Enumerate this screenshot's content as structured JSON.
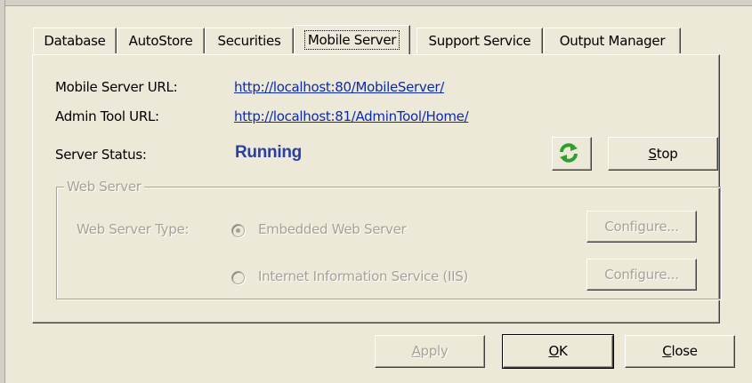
{
  "tabs": [
    "Database",
    "AutoStore",
    "Securities",
    "Mobile Server",
    "Support Service",
    "Output Manager"
  ],
  "active_tab": "Mobile Server",
  "mobile_server_url_label": "Mobile Server URL:",
  "mobile_server_url": "http://localhost:80/MobileServer/",
  "admin_tool_url_label": "Admin Tool URL:",
  "admin_tool_url": "http://localhost:81/AdminTool/Home/",
  "server_status_label": "Server Status:",
  "server_status": "Running",
  "refresh_icon": "refresh-icon",
  "stop_button": {
    "pre": "",
    "u": "S",
    "post": "top"
  },
  "web_server": {
    "title": "Web Server",
    "type_label": "Web Server Type:",
    "options": [
      {
        "label": "Embedded Web Server",
        "selected": true
      },
      {
        "label": "Internet Information Service (IIS)",
        "selected": false
      }
    ],
    "configure_label": "Configure..."
  },
  "buttons": {
    "apply": {
      "u": "A",
      "post": "pply"
    },
    "ok": {
      "u": "O",
      "post": "K"
    },
    "close": {
      "u": "C",
      "post": "lose"
    }
  },
  "colors": {
    "accent_link": "#0d2aa8",
    "status_running": "#2b3fa0",
    "dialog_bg": "#ece9d8"
  }
}
